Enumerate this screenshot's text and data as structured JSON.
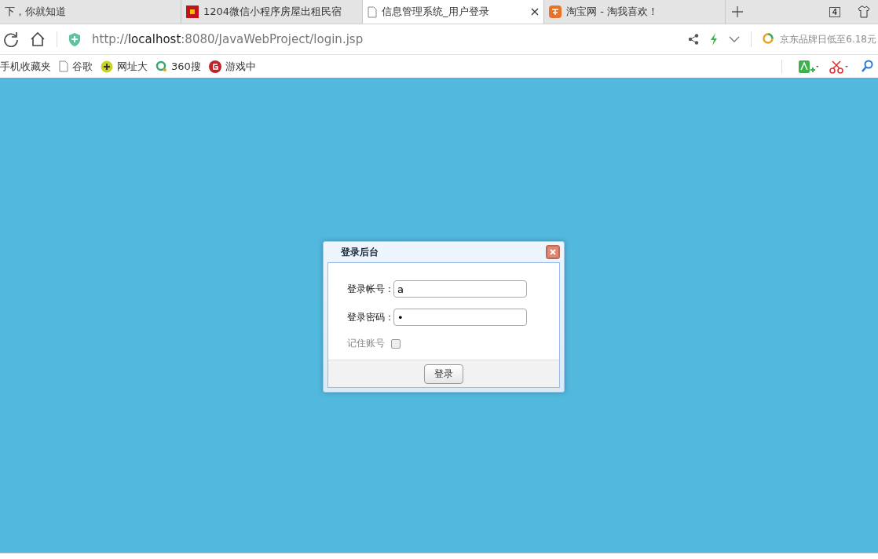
{
  "tabs": [
    {
      "title": "下，你就知道",
      "selected": false
    },
    {
      "title": "1204微信小程序房屋出租民宿",
      "selected": false
    },
    {
      "title": "信息管理系统_用户登录",
      "selected": true
    },
    {
      "title": "淘宝网 - 淘我喜欢！",
      "selected": false
    }
  ],
  "tab_count": "4",
  "url": {
    "scheme": "http://",
    "host": "localhost",
    "rest": ":8080/JavaWebProject/login.jsp"
  },
  "ad_text": "京东品牌日低至6.18元",
  "bookmarks": [
    {
      "label": "手机收藏夹"
    },
    {
      "label": "谷歌"
    },
    {
      "label": "网址大"
    },
    {
      "label": "360搜"
    },
    {
      "label": "游戏中"
    }
  ],
  "dialog": {
    "title": "登录后台",
    "fields": [
      {
        "label": "登录帐号：",
        "value": "a"
      },
      {
        "label": "登录密码：",
        "value": "•"
      }
    ],
    "remember": {
      "label": "记住账号",
      "checked": false,
      "disabled": true
    },
    "submit": "登录"
  }
}
